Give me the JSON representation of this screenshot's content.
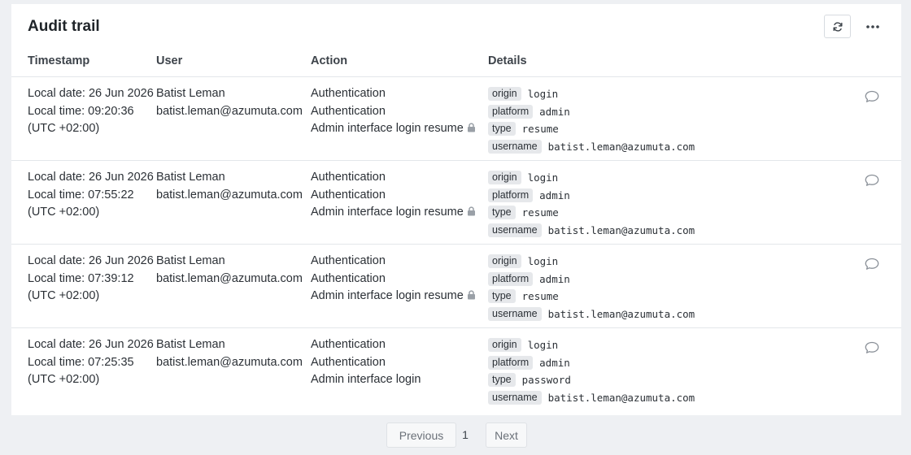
{
  "title": "Audit trail",
  "columns": [
    "Timestamp",
    "User",
    "Action",
    "Details"
  ],
  "rows": [
    {
      "ts": [
        "Local date: 26 Jun 2026",
        "Local time: 09:20:36",
        "(UTC +02:00)"
      ],
      "user": [
        "Batist Leman",
        "batist.leman@azumuta.com"
      ],
      "action": [
        "Authentication",
        "Authentication",
        "Admin interface login resume"
      ],
      "locked": true,
      "details": [
        {
          "key": "origin",
          "value": "login"
        },
        {
          "key": "platform",
          "value": "admin"
        },
        {
          "key": "type",
          "value": "resume"
        },
        {
          "key": "username",
          "value": "batist.leman@azumuta.com"
        }
      ]
    },
    {
      "ts": [
        "Local date: 26 Jun 2026",
        "Local time: 07:55:22",
        "(UTC +02:00)"
      ],
      "user": [
        "Batist Leman",
        "batist.leman@azumuta.com"
      ],
      "action": [
        "Authentication",
        "Authentication",
        "Admin interface login resume"
      ],
      "locked": true,
      "details": [
        {
          "key": "origin",
          "value": "login"
        },
        {
          "key": "platform",
          "value": "admin"
        },
        {
          "key": "type",
          "value": "resume"
        },
        {
          "key": "username",
          "value": "batist.leman@azumuta.com"
        }
      ]
    },
    {
      "ts": [
        "Local date: 26 Jun 2026",
        "Local time: 07:39:12",
        "(UTC +02:00)"
      ],
      "user": [
        "Batist Leman",
        "batist.leman@azumuta.com"
      ],
      "action": [
        "Authentication",
        "Authentication",
        "Admin interface login resume"
      ],
      "locked": true,
      "details": [
        {
          "key": "origin",
          "value": "login"
        },
        {
          "key": "platform",
          "value": "admin"
        },
        {
          "key": "type",
          "value": "resume"
        },
        {
          "key": "username",
          "value": "batist.leman@azumuta.com"
        }
      ]
    },
    {
      "ts": [
        "Local date: 26 Jun 2026",
        "Local time: 07:25:35",
        "(UTC +02:00)"
      ],
      "user": [
        "Batist Leman",
        "batist.leman@azumuta.com"
      ],
      "action": [
        "Authentication",
        "Authentication",
        "Admin interface login"
      ],
      "locked": false,
      "details": [
        {
          "key": "origin",
          "value": "login"
        },
        {
          "key": "platform",
          "value": "admin"
        },
        {
          "key": "type",
          "value": "password"
        },
        {
          "key": "username",
          "value": "batist.leman@azumuta.com"
        }
      ]
    }
  ],
  "pagination": {
    "previous": "Previous",
    "current": "1",
    "next": "Next"
  },
  "icons": {
    "refresh": "refresh-icon",
    "more": "more-horizontal-icon",
    "lock": "lock-icon",
    "comment": "comment-icon"
  }
}
